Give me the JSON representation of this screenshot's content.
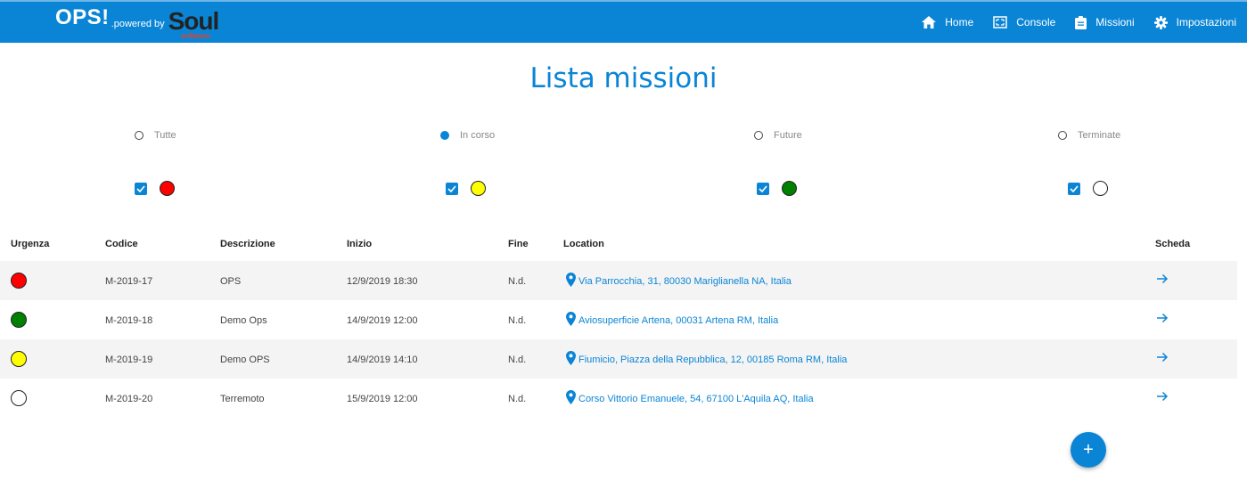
{
  "brand": {
    "name": "OPS!",
    "powered_by": ".powered by",
    "logo_text": "Soul",
    "logo_sub": "software"
  },
  "nav": [
    {
      "label": "Home",
      "icon": "home-icon"
    },
    {
      "label": "Console",
      "icon": "console-icon"
    },
    {
      "label": "Missioni",
      "icon": "clipboard-icon"
    },
    {
      "label": "Impostazioni",
      "icon": "gear-icon"
    }
  ],
  "page_title": "Lista missioni",
  "filters": {
    "options": [
      {
        "label": "Tutte",
        "selected": false
      },
      {
        "label": "In corso",
        "selected": true
      },
      {
        "label": "Future",
        "selected": false
      },
      {
        "label": "Terminate",
        "selected": false
      }
    ],
    "urgency_checks": [
      {
        "color": "#ff0000",
        "checked": true
      },
      {
        "color": "#ffff00",
        "checked": true
      },
      {
        "color": "#008000",
        "checked": true
      },
      {
        "color": "#ffffff",
        "checked": true
      }
    ]
  },
  "table": {
    "headers": {
      "urgenza": "Urgenza",
      "codice": "Codice",
      "descrizione": "Descrizione",
      "inizio": "Inizio",
      "fine": "Fine",
      "location": "Location",
      "scheda": "Scheda"
    },
    "rows": [
      {
        "urgency_color": "#ff0000",
        "codice": "M-2019-17",
        "descrizione": "OPS",
        "inizio": "12/9/2019 18:30",
        "fine": "N.d.",
        "location": "Via Parrocchia, 31, 80030 Mariglianella NA, Italia"
      },
      {
        "urgency_color": "#008000",
        "codice": "M-2019-18",
        "descrizione": "Demo Ops",
        "inizio": "14/9/2019 12:00",
        "fine": "N.d.",
        "location": "Aviosuperficie Artena, 00031 Artena RM, Italia"
      },
      {
        "urgency_color": "#ffff00",
        "codice": "M-2019-19",
        "descrizione": "Demo OPS",
        "inizio": "14/9/2019 14:10",
        "fine": "N.d.",
        "location": "Fiumicio, Piazza della Repubblica, 12, 00185 Roma RM, Italia"
      },
      {
        "urgency_color": "#ffffff",
        "codice": "M-2019-20",
        "descrizione": "Terremoto",
        "inizio": "15/9/2019 12:00",
        "fine": "N.d.",
        "location": "Corso Vittorio Emanuele, 54, 67100 L'Aquila AQ, Italia"
      }
    ]
  },
  "fab_label": "+",
  "colors": {
    "primary": "#0a85d6",
    "row_alt": "#f4f4f4"
  }
}
